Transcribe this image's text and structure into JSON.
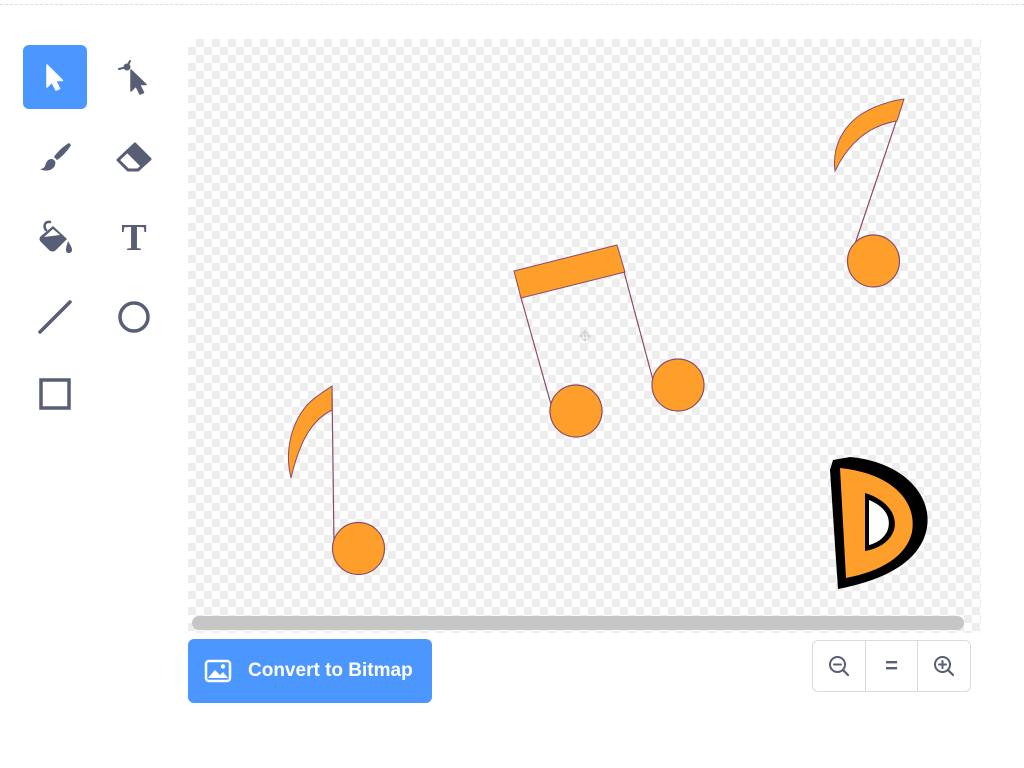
{
  "toolbar": {
    "tools": [
      {
        "name": "select",
        "icon": "arrow-pointer-icon",
        "active": true
      },
      {
        "name": "reshape",
        "icon": "reshape-pointer-icon",
        "active": false
      },
      {
        "name": "brush",
        "icon": "brush-icon",
        "active": false
      },
      {
        "name": "eraser",
        "icon": "eraser-icon",
        "active": false
      },
      {
        "name": "fill",
        "icon": "paint-bucket-icon",
        "active": false
      },
      {
        "name": "text",
        "icon": "text-tool-icon",
        "active": false
      },
      {
        "name": "line",
        "icon": "line-icon",
        "active": false
      },
      {
        "name": "circle",
        "icon": "circle-icon",
        "active": false
      },
      {
        "name": "rectangle",
        "icon": "rectangle-icon",
        "active": false
      }
    ],
    "text_tool_glyph": "T"
  },
  "canvas": {
    "artwork": [
      "eighth-note-left",
      "beamed-notes-center",
      "eighth-note-top-right",
      "letter-d-logo"
    ],
    "colors": {
      "note_fill": "#ff9f2b",
      "note_stroke": "#8c4b6a",
      "letter_outline": "#000000"
    }
  },
  "bottom_bar": {
    "convert_label": "Convert to Bitmap",
    "convert_icon": "image-icon",
    "zoom": {
      "zoom_out_icon": "zoom-out-icon",
      "reset_label": "=",
      "zoom_in_icon": "zoom-in-icon"
    }
  },
  "theme": {
    "accent": "#4c97ff",
    "icon_color": "#575e75"
  }
}
